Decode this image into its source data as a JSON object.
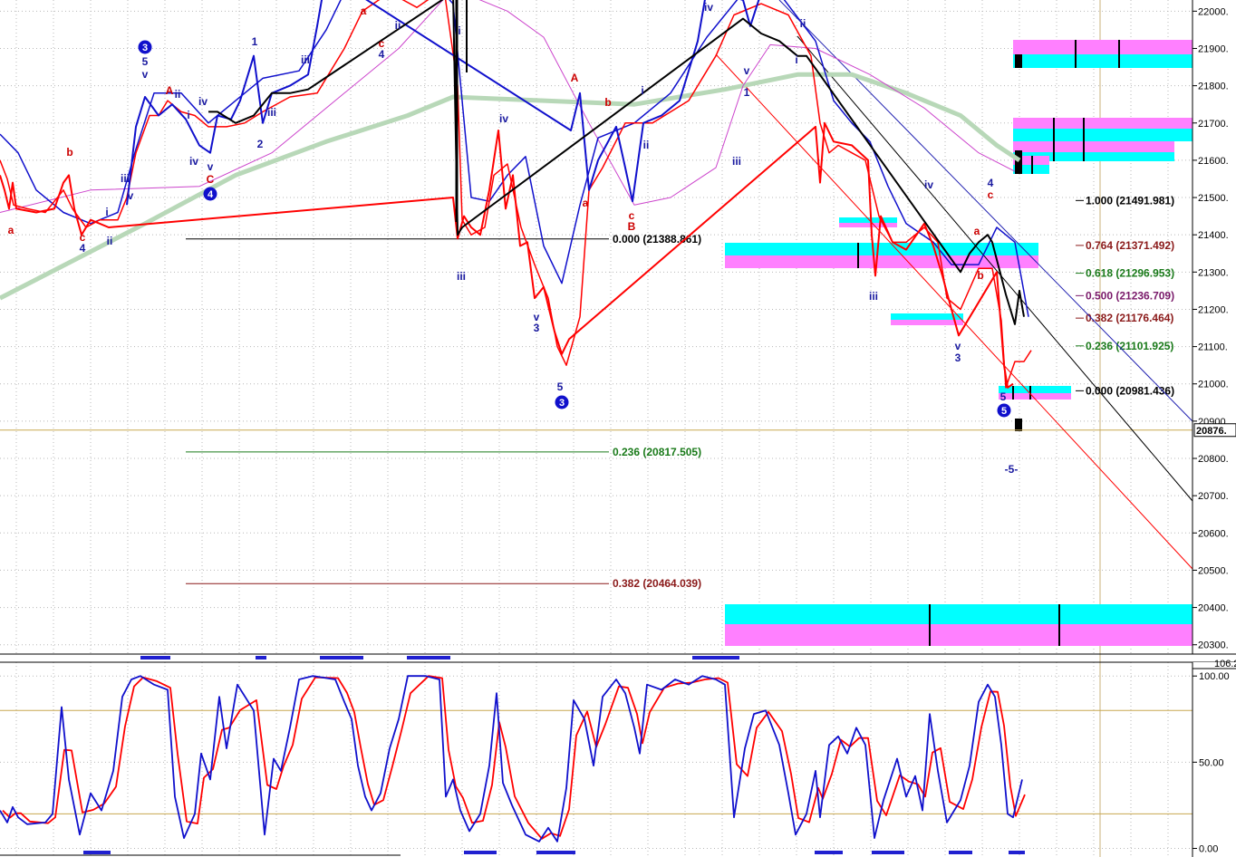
{
  "chart_data": [
    {
      "type": "line",
      "ylim": [
        20275,
        22030
      ],
      "y_ticks": [
        {
          "value": 22000,
          "label": "22000."
        },
        {
          "value": 21900,
          "label": "21900."
        },
        {
          "value": 21800,
          "label": "21800."
        },
        {
          "value": 21700,
          "label": "21700."
        },
        {
          "value": 21600,
          "label": "21600."
        },
        {
          "value": 21500,
          "label": "21500."
        },
        {
          "value": 21400,
          "label": "21400."
        },
        {
          "value": 21300,
          "label": "21300."
        },
        {
          "value": 21200,
          "label": "21200."
        },
        {
          "value": 21100,
          "label": "21100."
        },
        {
          "value": 21000,
          "label": "21000."
        },
        {
          "value": 20900,
          "label": "20900."
        },
        {
          "value": 20800,
          "label": "20800."
        },
        {
          "value": 20700,
          "label": "20700."
        },
        {
          "value": 20600,
          "label": "20600."
        },
        {
          "value": 20500,
          "label": "20500."
        },
        {
          "value": 20400,
          "label": "20400."
        },
        {
          "value": 20300,
          "label": "20300."
        }
      ],
      "last_price": {
        "value": 20876,
        "label": "20876.",
        "color": "#000000"
      },
      "fib_levels_right": [
        {
          "ratio": "1.000",
          "value": 21491.981,
          "label": "1.000 (21491.981)",
          "color": "#000000"
        },
        {
          "ratio": "0.764",
          "value": 21371.492,
          "label": "0.764 (21371.492)",
          "color": "#8b1a1a"
        },
        {
          "ratio": "0.618",
          "value": 21296.953,
          "label": "0.618 (21296.953)",
          "color": "#1a7a1a"
        },
        {
          "ratio": "0.500",
          "value": 21236.709,
          "label": "0.500 (21236.709)",
          "color": "#7a1a6a"
        },
        {
          "ratio": "0.382",
          "value": 21176.464,
          "label": "0.382 (21176.464)",
          "color": "#8b1a1a"
        },
        {
          "ratio": "0.236",
          "value": 21101.925,
          "label": "0.236 (21101.925)",
          "color": "#1a7a1a"
        },
        {
          "ratio": "0.000",
          "value": 20981.436,
          "label": "0.000 (20981.436)",
          "color": "#000000"
        }
      ],
      "fib_levels_left": [
        {
          "ratio": "0.000",
          "value": 21388.861,
          "label": "0.000 (21388.861)",
          "color": "#000000"
        },
        {
          "ratio": "0.236",
          "value": 20817.505,
          "label": "0.236 (20817.505)",
          "color": "#1a7a1a"
        },
        {
          "ratio": "0.382",
          "value": 20464.039,
          "label": "0.382 (20464.039)",
          "color": "#8b1a1a"
        }
      ],
      "series": [
        {
          "color": "#ff0000"
        },
        {
          "color": "#1010cc"
        },
        {
          "color": "#cc44cc"
        },
        {
          "color": "#b8d8b8"
        }
      ],
      "wave_labels": [
        {
          "text": "a",
          "color": "#cc0000"
        },
        {
          "text": "b",
          "color": "#cc0000"
        },
        {
          "text": "c",
          "color": "#cc0000"
        },
        {
          "text": "4",
          "color": "#1a1aa0"
        },
        {
          "text": "i",
          "color": "#1a1aa0"
        },
        {
          "text": "ii",
          "color": "#1a1aa0"
        },
        {
          "text": "iii",
          "color": "#1a1aa0"
        },
        {
          "text": "iv",
          "color": "#1a1aa0"
        },
        {
          "text": "v",
          "color": "#1a1aa0"
        },
        {
          "text": "5",
          "color": "#1a1aa0"
        },
        {
          "text": "A",
          "color": "#cc0000"
        },
        {
          "text": "B",
          "color": "#cc0000"
        },
        {
          "text": "C",
          "color": "#cc0000"
        },
        {
          "text": "1",
          "color": "#1a1aa0"
        },
        {
          "text": "2",
          "color": "#1a1aa0"
        },
        {
          "text": "3",
          "color": "#1a1aa0"
        },
        {
          "text": "-5-",
          "color": "#1a1aa0"
        }
      ],
      "circled_labels": [
        "3",
        "4",
        "3",
        "5"
      ]
    },
    {
      "type": "line",
      "ylim": [
        -5,
        108
      ],
      "y_ticks": [
        {
          "value": 100,
          "label": "100.00"
        },
        {
          "value": 50,
          "label": "50.00"
        },
        {
          "value": 0,
          "label": "0.00"
        }
      ],
      "top_value": {
        "value": 106.2,
        "label": "106.2"
      },
      "reference_lines": [
        80,
        20
      ],
      "series": [
        {
          "color": "#1010cc"
        },
        {
          "color": "#ff0000"
        }
      ]
    }
  ]
}
